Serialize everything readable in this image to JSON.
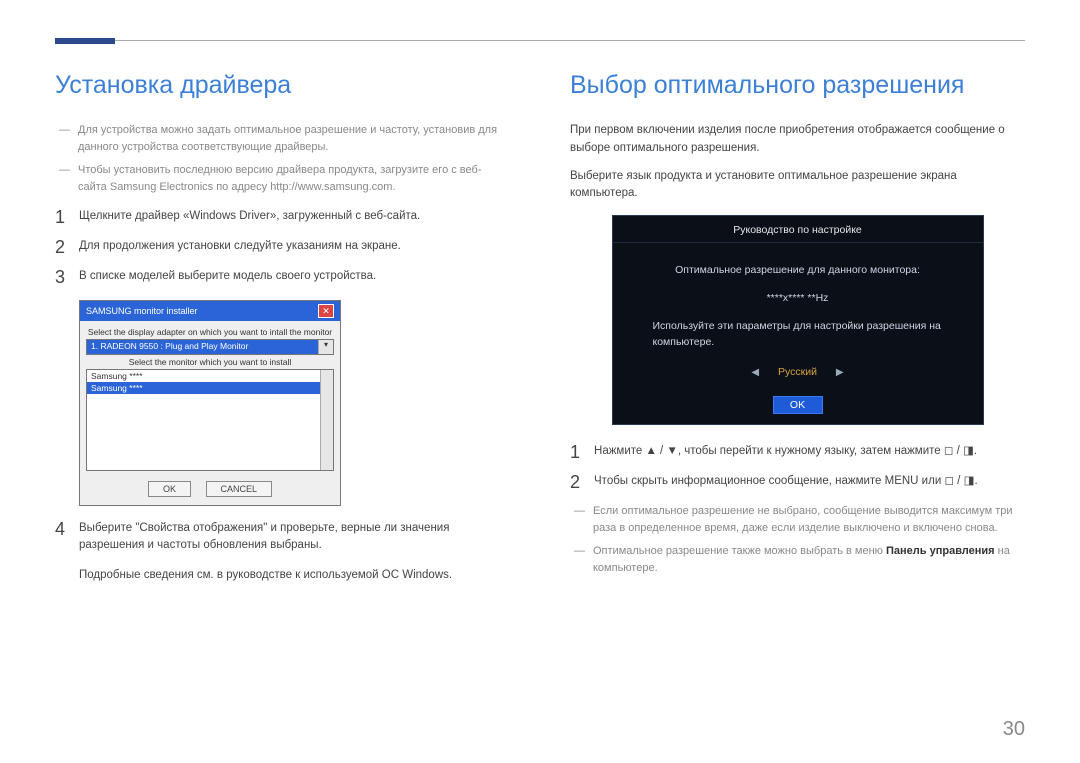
{
  "left": {
    "heading": "Установка драйвера",
    "notes": [
      "Для устройства можно задать оптимальное разрешение и частоту, установив для данного устройства соответствующие драйверы.",
      "Чтобы установить последнюю версию драйвера продукта, загрузите его с веб-сайта Samsung Electronics по адресу http://www.samsung.com."
    ],
    "steps": {
      "s1": "Щелкните драйвер «Windows Driver», загруженный с веб-сайта.",
      "s2": "Для продолжения установки следуйте указаниям на экране.",
      "s3": "В списке моделей выберите модель своего устройства.",
      "s4": "Выберите \"Свойства отображения\" и проверьте, верные ли значения разрешения и частоты обновления выбраны."
    },
    "footnote": "Подробные сведения см. в руководстве к используемой ОС Windows.",
    "installer": {
      "title": "SAMSUNG monitor installer",
      "label_top": "Select the display adapter on which you want to intall the monitor",
      "combo_text": "1. RADEON 9550 : Plug and Play Monitor",
      "label_mid": "Select the monitor which you want to install",
      "row1": "Samsung ****",
      "row2": "Samsung ****",
      "ok": "OK",
      "cancel": "CANCEL"
    }
  },
  "right": {
    "heading": "Выбор оптимального разрешения",
    "intro1": "При первом включении изделия после приобретения отображается сообщение о выборе оптимального разрешения.",
    "intro2": "Выберите язык продукта и установите оптимальное разрешение экрана компьютера.",
    "osd": {
      "title": "Руководство по настройке",
      "line1": "Оптимальное разрешение для данного монитора:",
      "res": "****x**** **Hz",
      "line2": "Используйте эти параметры для настройки разрешения на компьютере.",
      "lang": "Русский",
      "ok": "OK"
    },
    "steps": {
      "s1a": "Нажмите ",
      "s1b": ", чтобы перейти к нужному языку, затем нажмите ",
      "s1c": ".",
      "s2a": "Чтобы скрыть информационное сообщение, нажмите MENU или ",
      "s2b": "."
    },
    "notes": [
      "Если оптимальное разрешение не выбрано, сообщение выводится максимум три раза в определенное время, даже если изделие выключено и включено снова.",
      "Оптимальное разрешение также можно выбрать в меню "
    ],
    "note2suffix": " на компьютере.",
    "panel_label": "Панель управления"
  },
  "page_number": "30",
  "glyphs": {
    "up": "▲",
    "down": "▼",
    "left": "◀",
    "right": "▶",
    "btn1": "◻",
    "btn2": "◨",
    "dash": "―",
    "combo_arrow": "▾"
  }
}
